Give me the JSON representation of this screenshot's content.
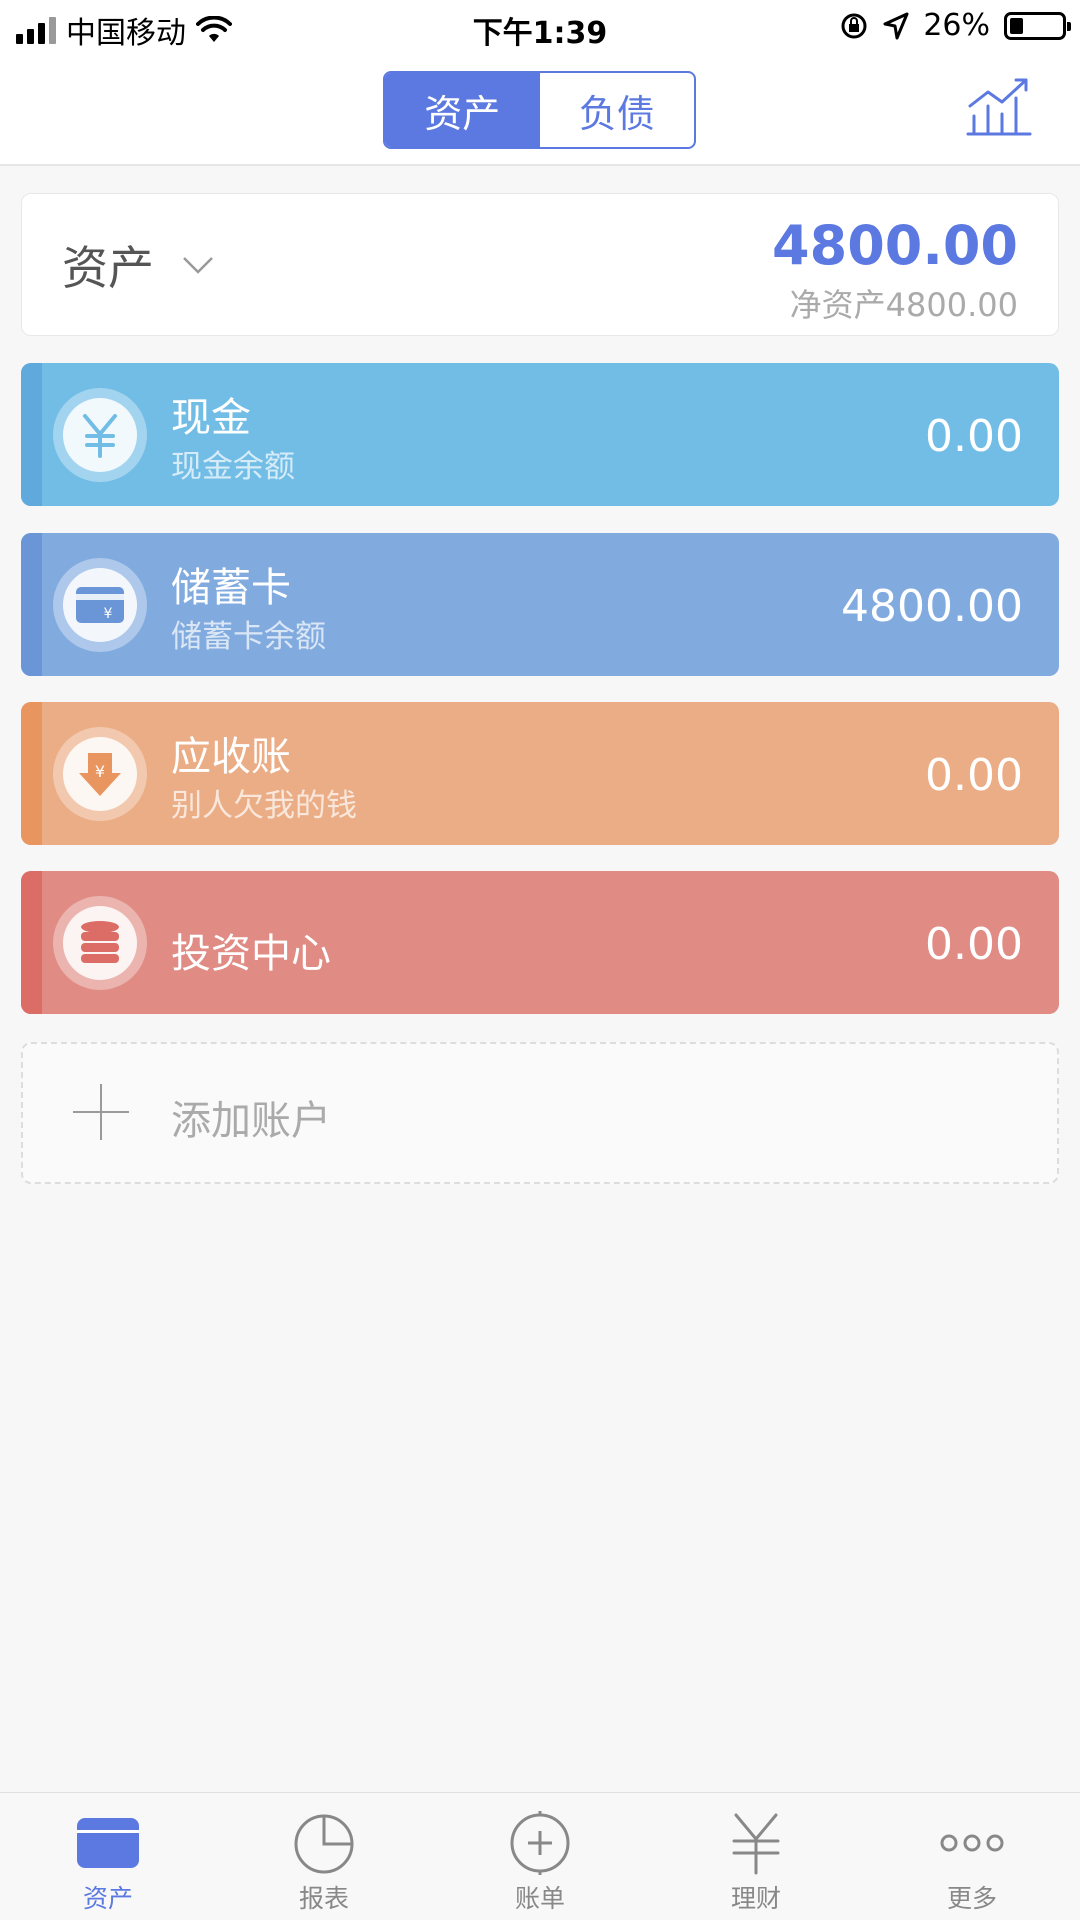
{
  "status_bar": {
    "carrier": "中国移动",
    "time": "下午1:39",
    "battery": "26%",
    "battery_level": 0.26
  },
  "header": {
    "tabs": [
      {
        "label": "资产",
        "active": true
      },
      {
        "label": "负债",
        "active": false
      }
    ],
    "chart_icon": "trend-chart-icon"
  },
  "summary": {
    "label": "资产",
    "amount": "4800.00",
    "net": "净资产4800.00"
  },
  "accounts": [
    {
      "name": "现金",
      "sub": "现金余额",
      "amount": "0.00",
      "icon": "yuan-icon",
      "color": "#72bde6",
      "strip": "#5fa9dc"
    },
    {
      "name": "储蓄卡",
      "sub": "储蓄卡余额",
      "amount": "4800.00",
      "icon": "bank-card-icon",
      "color": "#81abdf",
      "strip": "#6a95d6"
    },
    {
      "name": "应收账",
      "sub": "别人欠我的钱",
      "amount": "0.00",
      "icon": "receivable-icon",
      "color": "#ebad85",
      "strip": "#e99560"
    },
    {
      "name": "投资中心",
      "sub": "",
      "amount": "0.00",
      "icon": "coin-stack-icon",
      "color": "#e08c84",
      "strip": "#dc6c66"
    }
  ],
  "add_account": {
    "label": "添加账户"
  },
  "tabbar": {
    "items": [
      {
        "label": "资产",
        "icon": "card-icon",
        "active": true
      },
      {
        "label": "报表",
        "icon": "pie-chart-icon",
        "active": false
      },
      {
        "label": "账单",
        "icon": "add-circle-icon",
        "active": false
      },
      {
        "label": "理财",
        "icon": "yuan-icon",
        "active": false
      },
      {
        "label": "更多",
        "icon": "more-icon",
        "active": false
      }
    ]
  },
  "colors": {
    "accent": "#5b79e0",
    "text_muted": "#aaaaaa"
  }
}
